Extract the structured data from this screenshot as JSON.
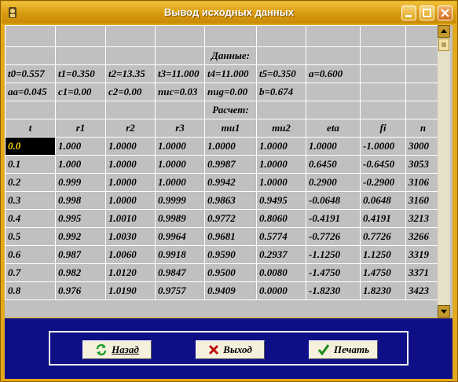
{
  "window": {
    "title": "Вывод исходных данных"
  },
  "table": {
    "params_title": "Данные:",
    "params_row1": [
      "t0=0.557",
      "t1=0.350",
      "t2=13.35",
      "t3=11.000",
      "t4=11.000",
      "t5=0.350",
      "a=0.600"
    ],
    "params_row2": [
      "aa=0.045",
      "c1=0.00",
      "c2=0.00",
      "nuc=0.03",
      "nug=0.00",
      "b=0.674"
    ],
    "calc_title": "Расчет:",
    "headers": [
      "t",
      "r1",
      "r2",
      "r3",
      "mu1",
      "mu2",
      "eta",
      "fi",
      "n"
    ],
    "rows": [
      [
        "0.0",
        "1.000",
        "1.0000",
        "1.0000",
        "1.0000",
        "1.0000",
        "1.0000",
        "-1.0000",
        "3000"
      ],
      [
        "0.1",
        "1.000",
        "1.0000",
        "1.0000",
        "0.9987",
        "1.0000",
        "0.6450",
        "-0.6450",
        "3053"
      ],
      [
        "0.2",
        "0.999",
        "1.0000",
        "1.0000",
        "0.9942",
        "1.0000",
        "0.2900",
        "-0.2900",
        "3106"
      ],
      [
        "0.3",
        "0.998",
        "1.0000",
        "0.9999",
        "0.9863",
        "0.9495",
        "-0.0648",
        "0.0648",
        "3160"
      ],
      [
        "0.4",
        "0.995",
        "1.0010",
        "0.9989",
        "0.9772",
        "0.8060",
        "-0.4191",
        "0.4191",
        "3213"
      ],
      [
        "0.5",
        "0.992",
        "1.0030",
        "0.9964",
        "0.9681",
        "0.5774",
        "-0.7726",
        "0.7726",
        "3266"
      ],
      [
        "0.6",
        "0.987",
        "1.0060",
        "0.9918",
        "0.9590",
        "0.2937",
        "-1.1250",
        "1.1250",
        "3319"
      ],
      [
        "0.7",
        "0.982",
        "1.0120",
        "0.9847",
        "0.9500",
        "0.0080",
        "-1.4750",
        "1.4750",
        "3371"
      ],
      [
        "0.8",
        "0.976",
        "1.0190",
        "0.9757",
        "0.9409",
        "0.0000",
        "-1.8230",
        "1.8230",
        "3423"
      ]
    ]
  },
  "buttons": {
    "back": "Назад",
    "exit": "Выход",
    "print": "Печать"
  },
  "icons": {
    "back": "refresh-arrows-icon",
    "exit": "red-x-icon",
    "print": "green-check-icon"
  }
}
